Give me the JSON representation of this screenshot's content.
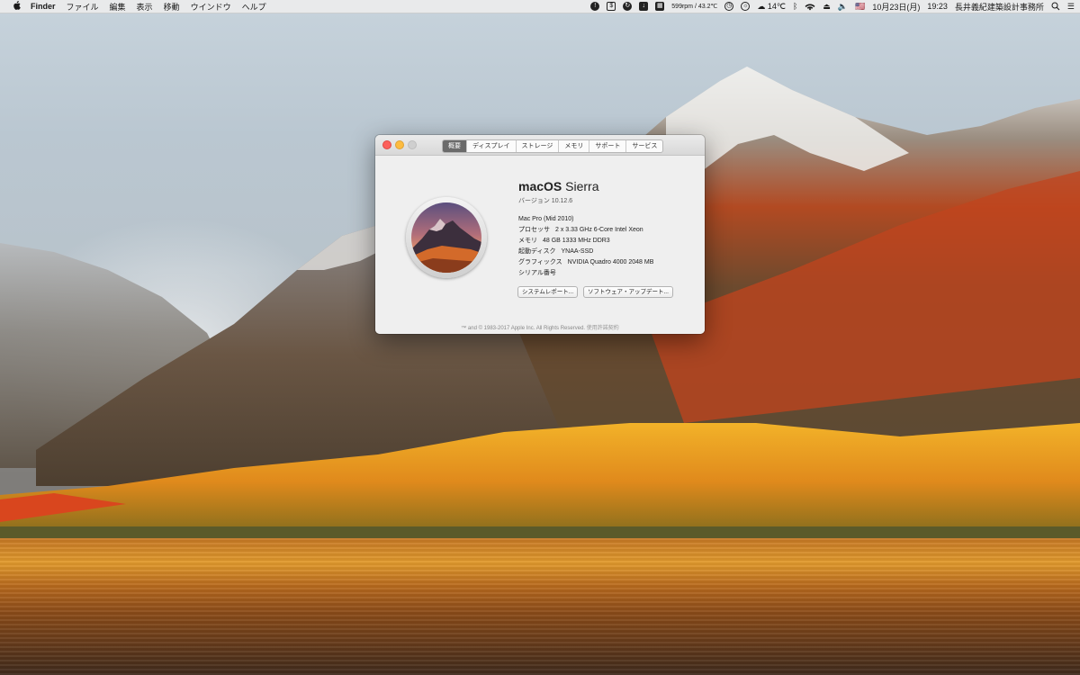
{
  "menubar": {
    "apple_label": "",
    "app_name": "Finder",
    "menus": [
      "ファイル",
      "編集",
      "表示",
      "移動",
      "ウインドウ",
      "ヘルプ"
    ],
    "status": {
      "fan_temp": "599rpm / 43.2℃",
      "weather": "14℃",
      "input_flag": "🇺🇸",
      "date": "10月23日(月)",
      "time": "19:23",
      "user": "長井義紀建築設計事務所"
    }
  },
  "about": {
    "tabs": [
      "概要",
      "ディスプレイ",
      "ストレージ",
      "メモリ",
      "サポート",
      "サービス"
    ],
    "active_tab": 0,
    "os_name_bold": "macOS",
    "os_name_light": "Sierra",
    "version_label": "バージョン 10.12.6",
    "model": "Mac Pro (Mid 2010)",
    "specs": [
      {
        "label": "プロセッサ",
        "value": "2 x 3.33 GHz 6-Core Intel Xeon"
      },
      {
        "label": "メモリ",
        "value": "48 GB 1333 MHz DDR3"
      },
      {
        "label": "起動ディスク",
        "value": "YNAA-SSD"
      },
      {
        "label": "グラフィックス",
        "value": "NVIDIA Quadro 4000 2048 MB"
      },
      {
        "label": "シリアル番号",
        "value": ""
      }
    ],
    "buttons": {
      "system_report": "システムレポート...",
      "software_update": "ソフトウェア・アップデート..."
    },
    "copyright": "™ and © 1983-2017 Apple Inc. All Rights Reserved.",
    "license_link": "使用許諾契約"
  }
}
